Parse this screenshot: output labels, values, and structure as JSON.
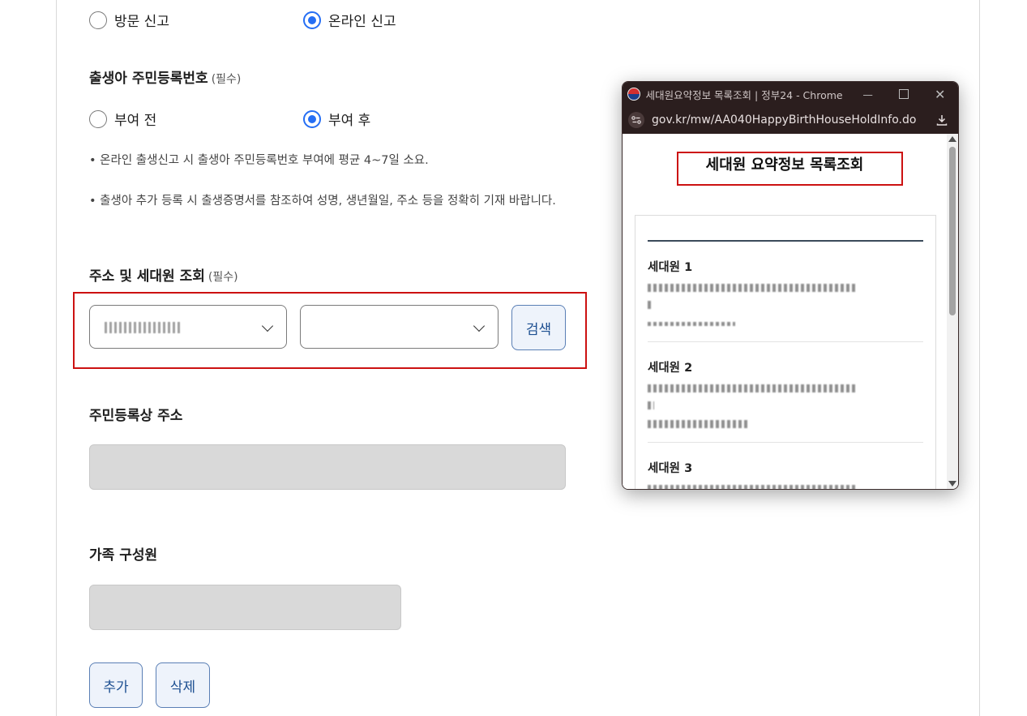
{
  "report_type": {
    "options": [
      {
        "label": "방문 신고",
        "checked": false
      },
      {
        "label": "온라인 신고",
        "checked": true
      }
    ]
  },
  "rrn_section": {
    "title": "출생아 주민등록번호",
    "required": "(필수)",
    "options": [
      {
        "label": "부여 전",
        "checked": false
      },
      {
        "label": "부여 후",
        "checked": true
      }
    ],
    "notes": [
      "• 온라인 출생신고 시 출생아 주민등록번호 부여에 평균 4~7일 소요.",
      "• 출생아 추가 등록 시 출생증명서를 참조하여 성명, 생년월일, 주소 등을 정확히 기재 바랍니다."
    ]
  },
  "address_section": {
    "title": "주소 및 세대원 조회",
    "required": "(필수)",
    "search_label": "검색"
  },
  "registered_address": {
    "title": "주민등록상 주소"
  },
  "family": {
    "title": "가족 구성원"
  },
  "actions": {
    "add_label": "추가",
    "delete_label": "삭제"
  },
  "popup": {
    "window_title": "세대원요약정보 목록조회 | 정부24 - Chrome",
    "url": "gov.kr/mw/AA040HappyBirthHouseHoldInfo.do",
    "heading": "세대원 요약정보 목록조회",
    "members": [
      {
        "label": "세대원 1"
      },
      {
        "label": "세대원 2"
      },
      {
        "label": "세대원 3"
      }
    ]
  },
  "colors": {
    "accent": "#256ef4",
    "highlight": "#cc1111",
    "button_text": "#1d4f91"
  }
}
